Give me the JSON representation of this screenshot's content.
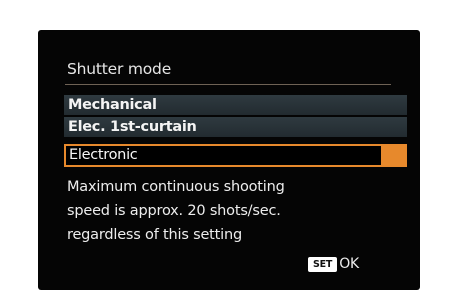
{
  "menu": {
    "title": "Shutter mode",
    "items": [
      {
        "label": "Mechanical"
      },
      {
        "label": "Elec. 1st-curtain"
      },
      {
        "label": "Electronic"
      }
    ],
    "selected_index": 2
  },
  "description": {
    "lines": [
      "Maximum continuous shooting",
      "speed is approx. 20 shots/sec.",
      "regardless of this setting"
    ]
  },
  "footer": {
    "set_label": "SET",
    "ok_label": "OK"
  },
  "colors": {
    "accent": "#e7892c",
    "item_bg": "#2a3338",
    "screen_bg": "#050505"
  }
}
